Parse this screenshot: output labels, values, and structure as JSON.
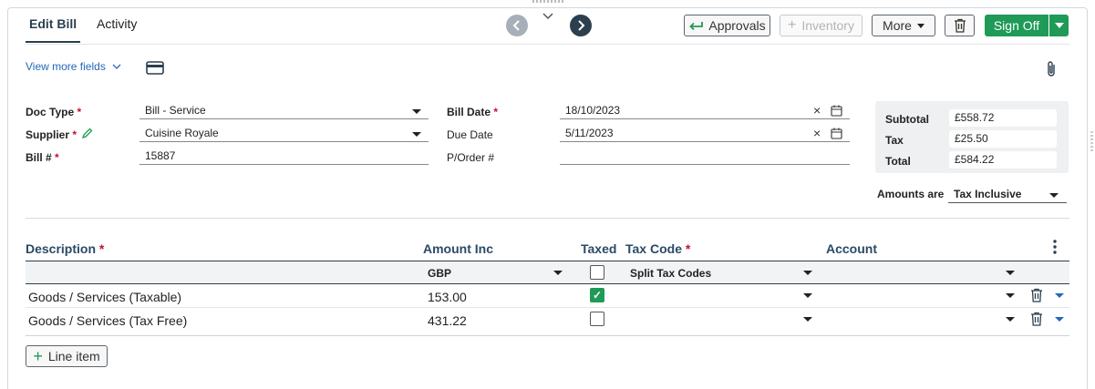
{
  "tabs": [
    {
      "label": "Edit Bill",
      "active": true
    },
    {
      "label": "Activity",
      "active": false
    }
  ],
  "toolbar": {
    "approvals_label": "Approvals",
    "inventory_label": "Inventory",
    "more_label": "More",
    "signoff_label": "Sign Off"
  },
  "links": {
    "view_more_fields": "View more fields"
  },
  "form": {
    "doc_type": {
      "label": "Doc Type",
      "value": "Bill - Service"
    },
    "supplier": {
      "label": "Supplier",
      "value": "Cuisine Royale"
    },
    "bill_no": {
      "label": "Bill #",
      "value": "15887"
    },
    "bill_date": {
      "label": "Bill Date",
      "value": "18/10/2023"
    },
    "due_date": {
      "label": "Due Date",
      "value": "5/11/2023"
    },
    "po": {
      "label": "P/Order #",
      "value": ""
    },
    "required_mark": "*"
  },
  "totals": {
    "subtotal_label": "Subtotal",
    "subtotal": "£558.72",
    "tax_label": "Tax",
    "tax": "£25.50",
    "total_label": "Total",
    "total": "£584.22"
  },
  "amounts_are": {
    "label": "Amounts are",
    "value": "Tax Inclusive"
  },
  "table": {
    "headers": {
      "description": "Description",
      "amount": "Amount Inc",
      "taxed": "Taxed",
      "taxcode": "Tax Code",
      "account": "Account"
    },
    "subheader": {
      "currency": "GBP",
      "taxcode": "Split Tax Codes",
      "taxed_checked": false
    },
    "rows": [
      {
        "description": "Goods / Services (Taxable)",
        "amount": "153.00",
        "taxed": true
      },
      {
        "description": "Goods / Services (Tax Free)",
        "amount": "431.22",
        "taxed": false
      }
    ]
  },
  "add_line_label": "Line item",
  "colors": {
    "accent": "#2b3f4f",
    "green": "#1f9a57",
    "required": "#c8102e",
    "link": "#2468b8"
  }
}
